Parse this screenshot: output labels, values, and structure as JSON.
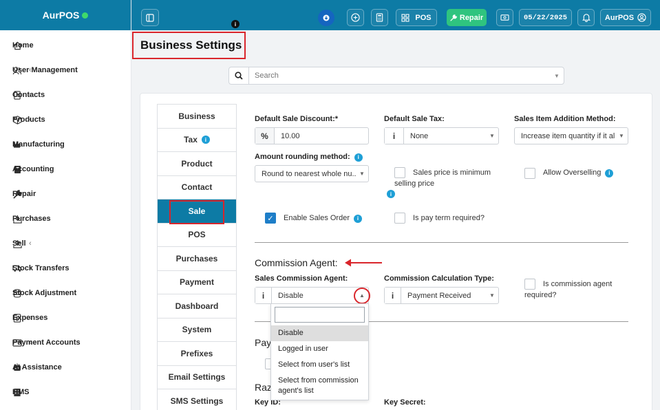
{
  "brand": {
    "name": "AurPOS"
  },
  "sidebar": {
    "items": [
      {
        "label": "Home",
        "icon": "home-icon",
        "has_sub": false
      },
      {
        "label": "User Management",
        "icon": "users-icon",
        "has_sub": true
      },
      {
        "label": "Contacts",
        "icon": "contacts-icon",
        "has_sub": true
      },
      {
        "label": "Products",
        "icon": "cube-icon",
        "has_sub": true
      },
      {
        "label": "Manufacturing",
        "icon": "industry-icon",
        "has_sub": false
      },
      {
        "label": "Accounting",
        "icon": "book-icon",
        "has_sub": false
      },
      {
        "label": "Repair",
        "icon": "wrench-icon",
        "has_sub": false
      },
      {
        "label": "Purchases",
        "icon": "download-icon",
        "has_sub": true
      },
      {
        "label": "Sell",
        "icon": "upload-icon",
        "has_sub": true
      },
      {
        "label": "Stock Transfers",
        "icon": "truck-icon",
        "has_sub": true
      },
      {
        "label": "Stock Adjustment",
        "icon": "database-icon",
        "has_sub": true
      },
      {
        "label": "Expenses",
        "icon": "dollar-icon",
        "has_sub": true
      },
      {
        "label": "Payment Accounts",
        "icon": "wallet-icon",
        "has_sub": true
      },
      {
        "label": "AI Assistance",
        "icon": "robot-icon",
        "has_sub": false
      },
      {
        "label": "HMS",
        "icon": "hotel-icon",
        "has_sub": false
      }
    ]
  },
  "topbar": {
    "pos_label": "POS",
    "repair_label": "Repair",
    "date": "05/22/2025",
    "user": "AurPOS"
  },
  "page": {
    "title": "Business Settings"
  },
  "search": {
    "placeholder": "Search"
  },
  "tabs": [
    {
      "label": "Business",
      "info": false
    },
    {
      "label": "Tax",
      "info": true
    },
    {
      "label": "Product",
      "info": false
    },
    {
      "label": "Contact",
      "info": false
    },
    {
      "label": "Sale",
      "info": false,
      "active": true
    },
    {
      "label": "POS",
      "info": false
    },
    {
      "label": "Purchases",
      "info": false
    },
    {
      "label": "Payment",
      "info": false
    },
    {
      "label": "Dashboard",
      "info": false
    },
    {
      "label": "System",
      "info": false
    },
    {
      "label": "Prefixes",
      "info": false
    },
    {
      "label": "Email Settings",
      "info": false
    },
    {
      "label": "SMS Settings",
      "info": false
    }
  ],
  "form": {
    "default_sale_discount": {
      "label": "Default Sale Discount:*",
      "addon": "%",
      "value": "10.00"
    },
    "default_sale_tax": {
      "label": "Default Sale Tax:",
      "value": "None"
    },
    "sales_item_addition": {
      "label": "Sales Item Addition Method:",
      "value": "Increase item quantity if it al..."
    },
    "amount_rounding": {
      "label": "Amount rounding method:",
      "value": "Round to nearest whole nu..."
    },
    "sales_price_minimum": {
      "line1": "Sales price is minimum",
      "line2": "selling price",
      "checked": false
    },
    "allow_overselling": {
      "label": "Allow Overselling",
      "checked": false
    },
    "enable_sales_order": {
      "label": "Enable Sales Order",
      "checked": true
    },
    "pay_term_required": {
      "label": "Is pay term required?",
      "checked": false
    }
  },
  "commission": {
    "section_title": "Commission Agent:",
    "agent_label": "Sales Commission Agent:",
    "agent_value": "Disable",
    "calc_label": "Commission Calculation Type:",
    "calc_value": "Payment Received",
    "required_line1": "Is commission agent",
    "required_line2": "required?",
    "options": [
      "Disable",
      "Logged in user",
      "Select from user's list",
      "Select from commission agent's list"
    ]
  },
  "partial": {
    "payment_prefix": "Pay",
    "razorpay_prefix": "Raz",
    "key_id": "Key ID:",
    "key_secret": "Key Secret:"
  },
  "colors": {
    "primary": "#0d7ba5",
    "accent_red": "#d9252b",
    "repair_green": "#2fc47f",
    "info_blue": "#1e9fd6"
  }
}
